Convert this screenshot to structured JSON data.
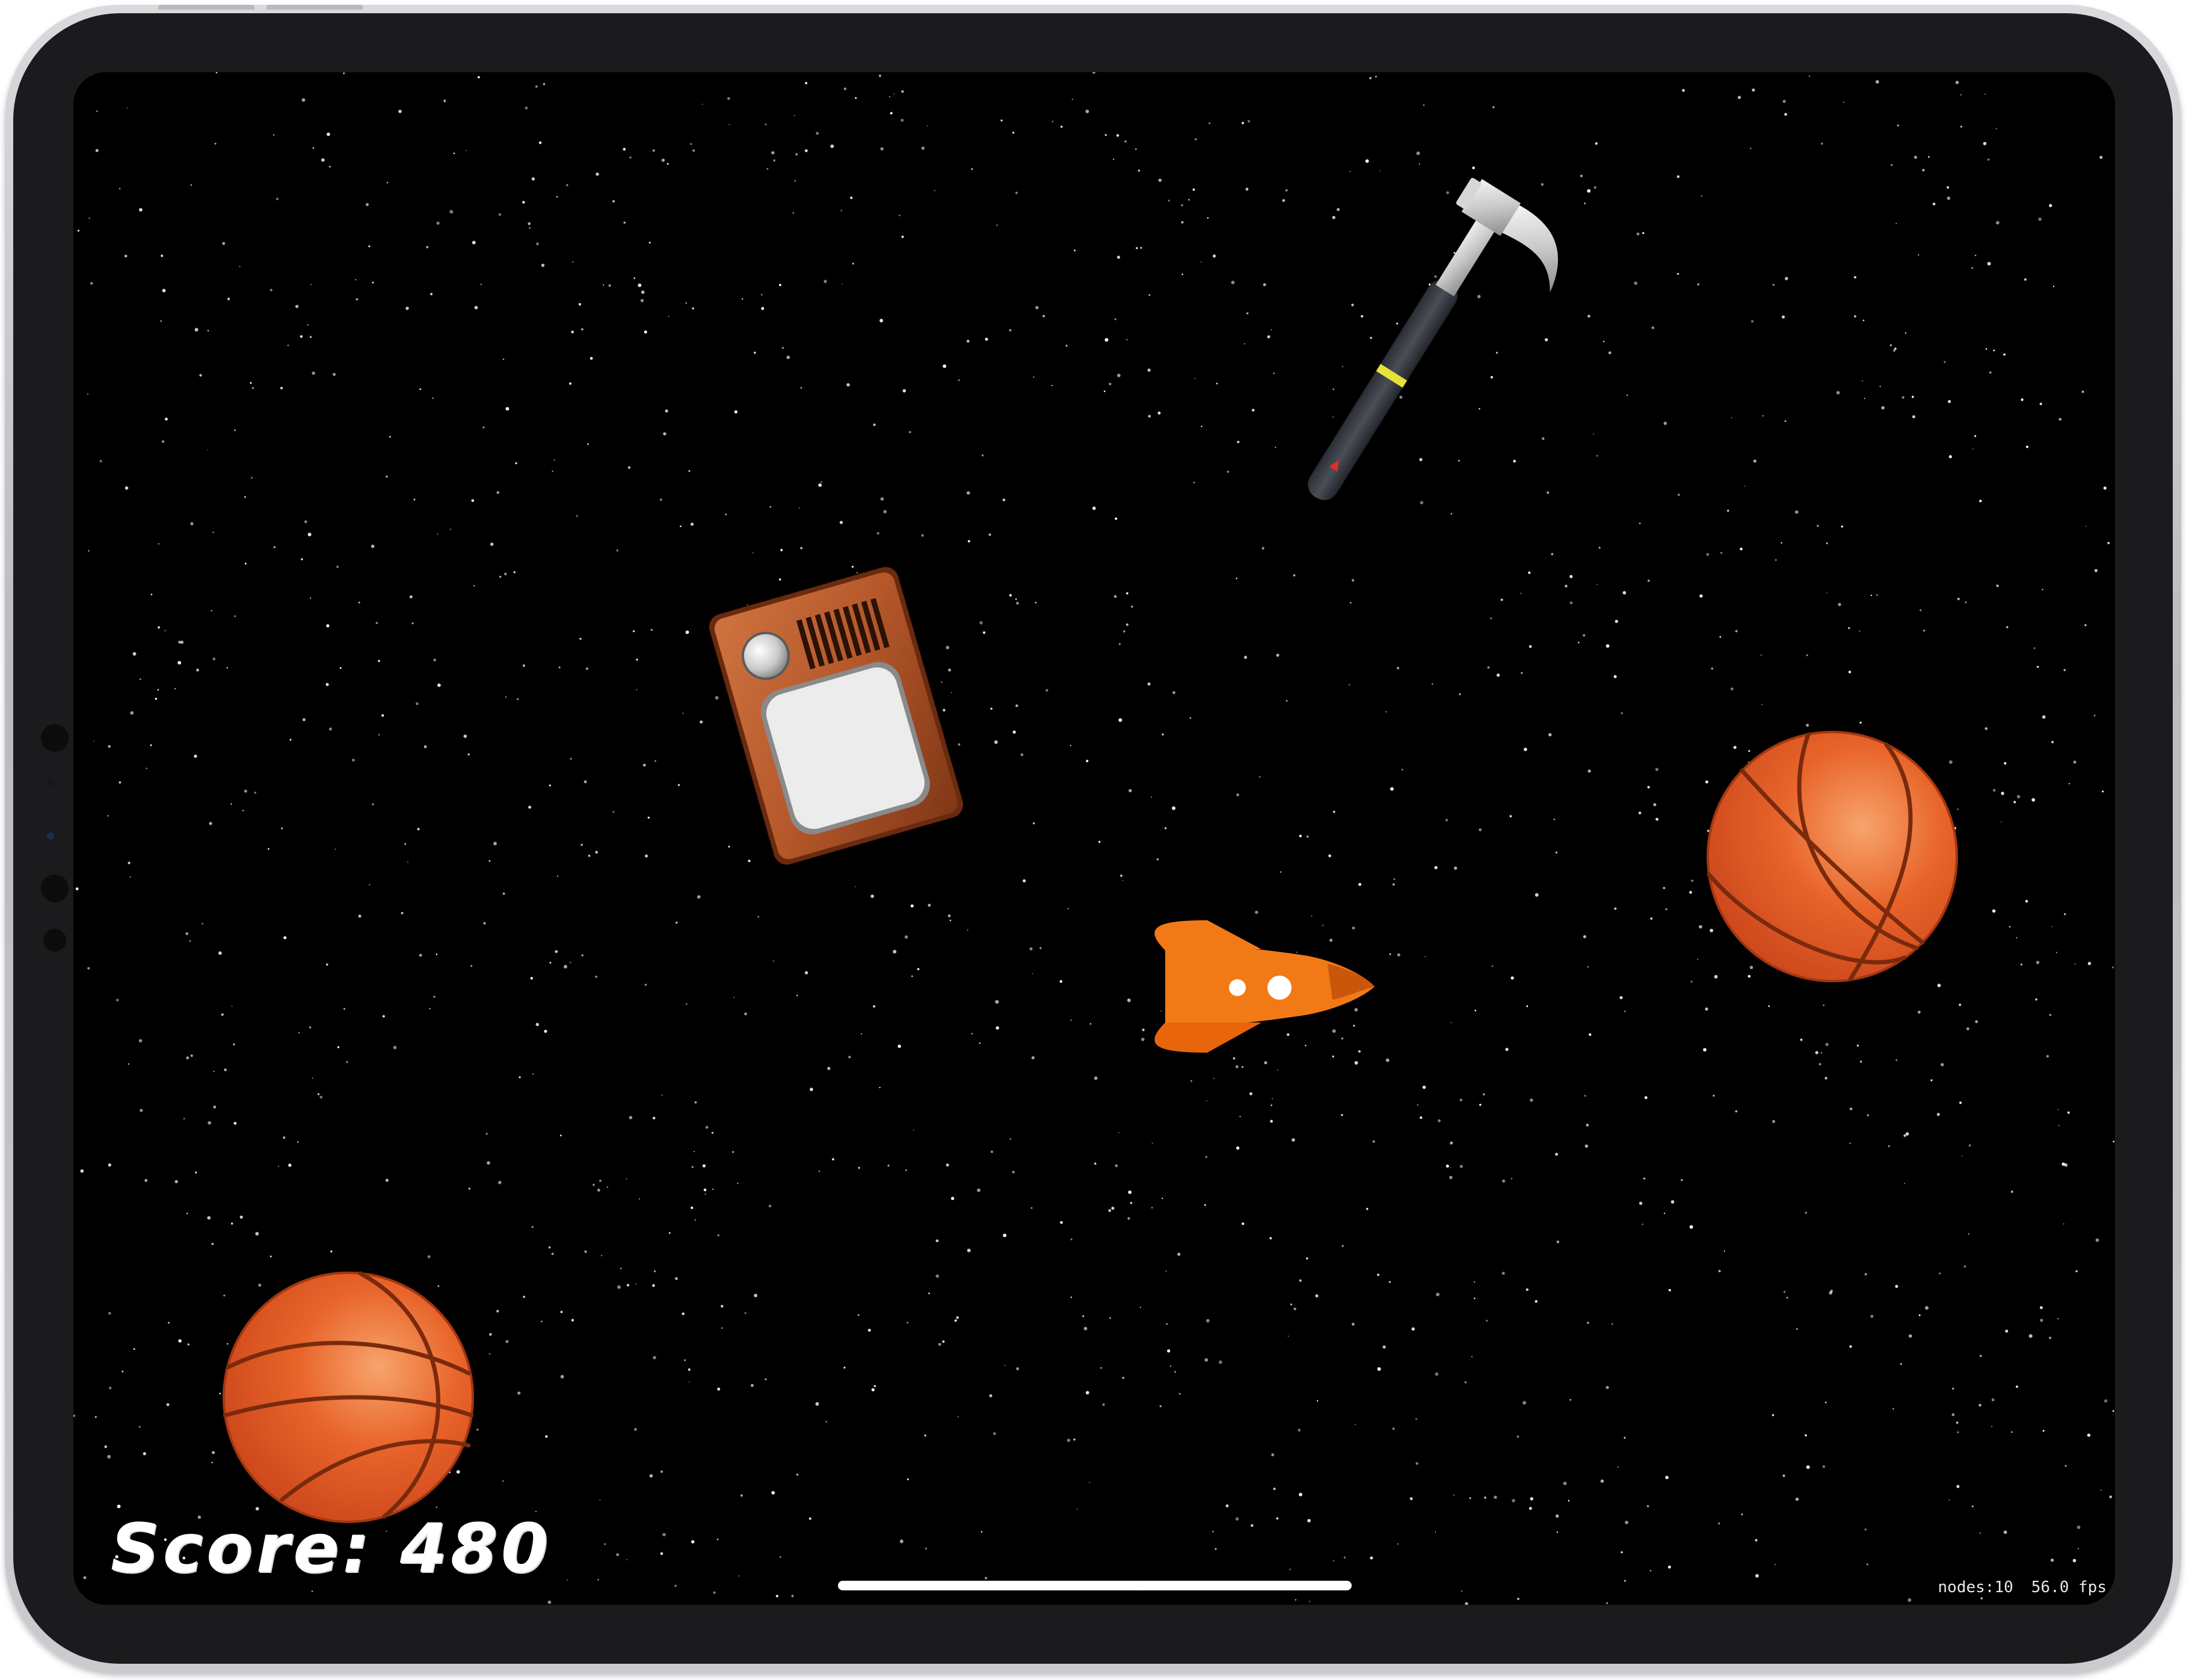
{
  "game": {
    "score_text": "Score: 480",
    "stats": {
      "nodes": "nodes:10",
      "fps": "56.0 fps"
    }
  },
  "sprites": [
    {
      "kind": "hammer-icon"
    },
    {
      "kind": "television-icon"
    },
    {
      "kind": "rocket-icon"
    },
    {
      "kind": "basketball-icon"
    },
    {
      "kind": "basketball-icon"
    }
  ],
  "colors": {
    "space": "#000000",
    "star": "#ffffff",
    "basketball": "#e8642a",
    "rocket": "#f27a16",
    "tv_wood": "#b4572a",
    "score_text": "#ffffff"
  }
}
